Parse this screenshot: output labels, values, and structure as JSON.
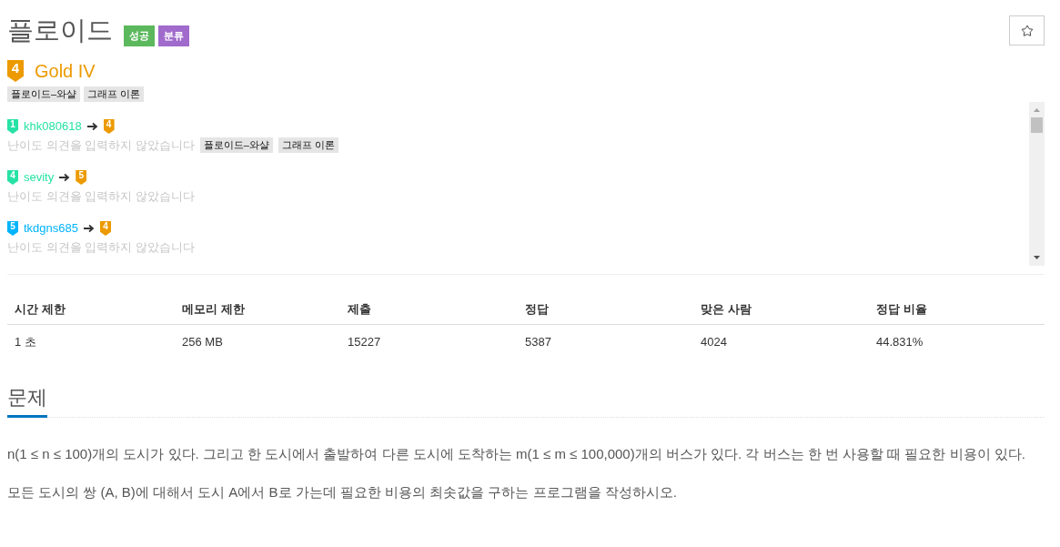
{
  "problem": {
    "title": "플로이드",
    "badges": [
      {
        "label": "성공",
        "color": "#5cb85c"
      },
      {
        "label": "분류",
        "color": "#a06bcc"
      }
    ],
    "starred": false
  },
  "tier": {
    "badge": "4",
    "name": "Gold IV",
    "color": "#ec9a00"
  },
  "tags": [
    "플로이드–와샬",
    "그래프 이론"
  ],
  "opinions": [
    {
      "user_tier": {
        "badge": "1",
        "color": "#27e2a4"
      },
      "username": "khk080618",
      "vote_tier": {
        "badge": "4",
        "color": "#ec9a00"
      },
      "comment": "난이도 의견을 입력하지 않았습니다",
      "tags": [
        "플로이드–와샬",
        "그래프 이론"
      ]
    },
    {
      "user_tier": {
        "badge": "4",
        "color": "#27e2a4"
      },
      "username": "sevity",
      "vote_tier": {
        "badge": "5",
        "color": "#ec9a00"
      },
      "comment": "난이도 의견을 입력하지 않았습니다"
    },
    {
      "user_tier": {
        "badge": "5",
        "color": "#00b4fc"
      },
      "username": "tkdgns685",
      "vote_tier": {
        "badge": "4",
        "color": "#ec9a00"
      },
      "comment": "난이도 의견을 입력하지 않았습니다"
    }
  ],
  "stats": {
    "columns": [
      "시간 제한",
      "메모리 제한",
      "제출",
      "정답",
      "맞은 사람",
      "정답 비율"
    ],
    "rows": [
      [
        "1 초",
        "256 MB",
        "15227",
        "5387",
        "4024",
        "44.831%"
      ]
    ]
  },
  "section": {
    "heading": "문제",
    "paragraphs": [
      "n(1 ≤ n ≤ 100)개의 도시가 있다. 그리고 한 도시에서 출발하여 다른 도시에 도착하는 m(1 ≤ m ≤ 100,000)개의 버스가 있다. 각 버스는 한 번 사용할 때 필요한 비용이 있다.",
      "모든 도시의 쌍 (A, B)에 대해서 도시 A에서 B로 가는데 필요한 비용의 최솟값을 구하는 프로그램을 작성하시오."
    ]
  }
}
